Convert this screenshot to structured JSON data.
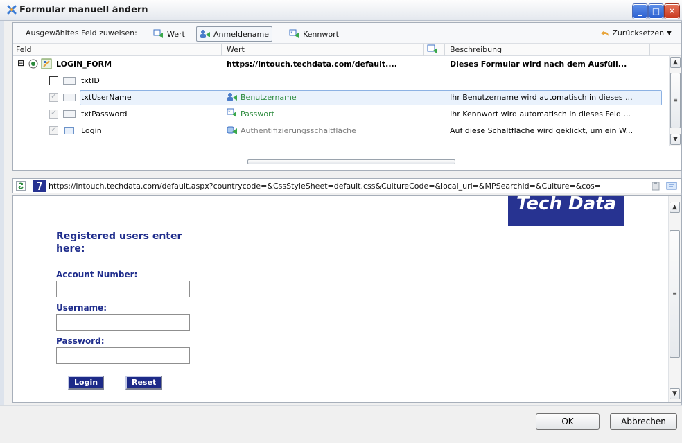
{
  "window": {
    "title": "Formular manuell ändern"
  },
  "toolbar": {
    "assign_label": "Ausgewähltes Feld zuweisen:",
    "wert_label": "Wert",
    "anmeldename_label": "Anmeldename",
    "kennwort_label": "Kennwort",
    "reset_label": "Zurücksetzen"
  },
  "columns": {
    "feld": "Feld",
    "wert": "Wert",
    "beschreibung": "Beschreibung"
  },
  "rows": [
    {
      "name": "LOGIN_FORM",
      "value": "https://intouch.techdata.com/default....",
      "description": "Dieses Formular wird nach dem Ausfüll..."
    },
    {
      "name": "txtID",
      "value": "",
      "description": ""
    },
    {
      "name": "txtUserName",
      "value": "Benutzername",
      "description": "Ihr Benutzername wird automatisch in dieses ..."
    },
    {
      "name": "txtPassword",
      "value": "Passwort",
      "description": "Ihr Kennwort wird automatisch in dieses Feld ..."
    },
    {
      "name": "Login",
      "value": "Authentifizierungsschaltfläche",
      "description": "Auf diese Schaltfläche wird geklickt, um ein W..."
    }
  ],
  "urlbar": {
    "url": "https://intouch.techdata.com/default.aspx?countrycode=&CssStyleSheet=default.css&CultureCode=&local_url=&MPSearchId=&Culture=&cos="
  },
  "page": {
    "logo_text": "Tech Data",
    "heading_line1": "Registered users enter",
    "heading_line2": "here:",
    "account_label": "Account Number:",
    "username_label": "Username:",
    "password_label": "Password:",
    "account_value": "",
    "username_value": "",
    "password_value": "",
    "login_button": "Login",
    "reset_button": "Reset"
  },
  "footer": {
    "ok_label": "OK",
    "cancel_label": "Abbrechen"
  },
  "colors": {
    "accent_blue": "#1f2d8c",
    "logo_bg": "#273391",
    "mapped_value_green": "#2c8b3d",
    "selection_bg": "#eaf2fc"
  }
}
